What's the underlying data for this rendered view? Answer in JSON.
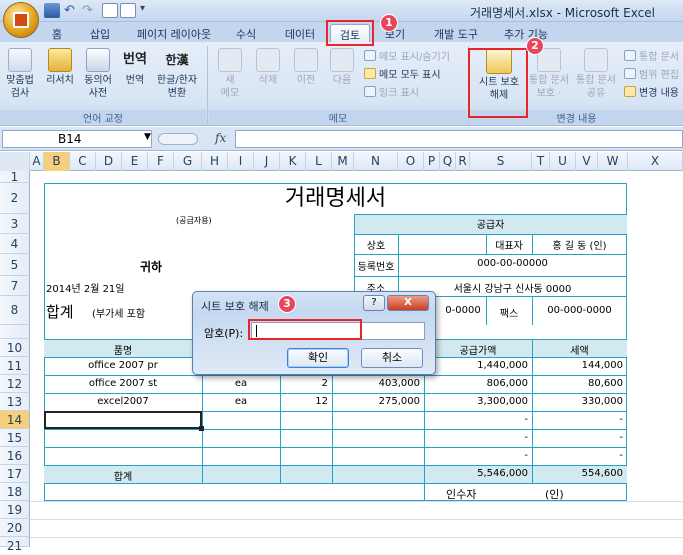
{
  "window": {
    "title": "거래명세서.xlsx - Microsoft Excel"
  },
  "ribbon_tabs": [
    "홈",
    "삽입",
    "페이지 레이아웃",
    "수식",
    "데이터",
    "검토",
    "보기",
    "개발 도구",
    "추가 기능"
  ],
  "ribbon": {
    "lang_group": {
      "label": "언어 교정",
      "buttons": [
        {
          "l1": "맞춤법",
          "l2": "검사"
        },
        {
          "l1": "리서치",
          "l2": ""
        },
        {
          "l1": "동의어",
          "l2": "사전"
        },
        {
          "l1": "번역",
          "l2": ""
        },
        {
          "l1": "한글/한자",
          "l2": "변환"
        }
      ],
      "icon_text": {
        "trans": "번역",
        "hanja": "한漢"
      }
    },
    "memo_group": {
      "label": "메모",
      "buttons": [
        {
          "l1": "새",
          "l2": "메모"
        },
        {
          "l1": "삭제",
          "l2": ""
        },
        {
          "l1": "이전",
          "l2": ""
        },
        {
          "l1": "다음",
          "l2": ""
        }
      ],
      "small": [
        "메모 표시/숨기기",
        "메모 모두 표시",
        "잉크 표시"
      ]
    },
    "change_group": {
      "label": "변경 내용",
      "unprotect": {
        "l1": "시트 보호",
        "l2": "해제"
      },
      "protect_wb": {
        "l1": "통합 문서",
        "l2": "보호 ·"
      },
      "share_wb": {
        "l1": "통합 문서",
        "l2": "공유"
      },
      "small": [
        "통합 문서",
        "범위 편집",
        "변경 내용"
      ]
    }
  },
  "formula_bar": {
    "name_box": "B14",
    "fx": "fx"
  },
  "columns": [
    "A",
    "B",
    "C",
    "D",
    "E",
    "F",
    "G",
    "H",
    "I",
    "J",
    "K",
    "L",
    "M",
    "N",
    "O",
    "P",
    "Q",
    "R",
    "S",
    "T",
    "U",
    "V",
    "W",
    "X"
  ],
  "rows": [
    "1",
    "2",
    "3",
    "4",
    "5",
    "7",
    "8",
    "10",
    "11",
    "12",
    "13",
    "14",
    "15",
    "16",
    "17",
    "18",
    "19",
    "20",
    "21"
  ],
  "sheet": {
    "title": "거래명세서",
    "small_note": "(공급자용)",
    "supplier": "공급자",
    "label_name": "상호",
    "label_rep": "대표자",
    "rep_name": "홍 길 동  (인)",
    "label_regno": "등록번호",
    "regno": "000-00-00000",
    "recipient": "귀하",
    "date": "2014년 2월 21일",
    "label_addr": "주소",
    "addr": "서울시 강남구 신사동 0000",
    "total_label": "합계",
    "vat_note": "(부가세 포함",
    "tel_partial": "0-0000",
    "label_fax": "팩스",
    "fax": "00-000-0000",
    "col_item": "품명",
    "col_supply": "공급가액",
    "col_tax": "세액",
    "items": [
      {
        "name": "office 2007 pr",
        "unit": "",
        "qty": "",
        "price": "",
        "supply": "1,440,000",
        "tax": "144,000"
      },
      {
        "name": "office 2007 st",
        "unit": "ea",
        "qty": "2",
        "price": "403,000",
        "supply": "806,000",
        "tax": "80,600"
      },
      {
        "name": "excel2007",
        "unit": "ea",
        "qty": "12",
        "price": "275,000",
        "supply": "3,300,000",
        "tax": "330,000"
      }
    ],
    "dash": "-",
    "sum_label": "합계",
    "sum_supply": "5,546,000",
    "sum_tax": "554,600",
    "receiver_label": "인수자",
    "receiver_sign": "(인)"
  },
  "dialog": {
    "title": "시트 보호 해제",
    "help": "?",
    "close": "X",
    "password_label": "암호(P):",
    "password_value": "",
    "ok": "확인",
    "cancel": "취소"
  },
  "annotations": [
    "1",
    "2",
    "3"
  ]
}
